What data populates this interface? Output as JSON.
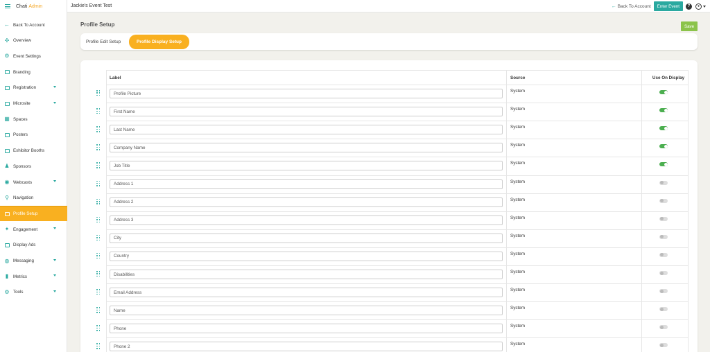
{
  "brand": {
    "name": "Chati",
    "suffix": "Admin"
  },
  "event": {
    "title": "Jackie's Event Test"
  },
  "topbar": {
    "back_label": "Back To Account",
    "enter_label": "Enter Event"
  },
  "sidebar": {
    "items": [
      {
        "label": "Back To Account",
        "icon": "arrow-left-icon",
        "glyph": "←",
        "caret": false,
        "active": false
      },
      {
        "label": "Overview",
        "icon": "overview-icon",
        "glyph": "✣",
        "caret": false,
        "active": false
      },
      {
        "label": "Event Settings",
        "icon": "settings-icon",
        "glyph": "⚙",
        "caret": false,
        "active": false
      },
      {
        "label": "Branding",
        "icon": "branding-icon",
        "glyph": "box",
        "caret": false,
        "active": false
      },
      {
        "label": "Registration",
        "icon": "registration-icon",
        "glyph": "box",
        "caret": true,
        "active": false
      },
      {
        "label": "Microsite",
        "icon": "microsite-icon",
        "glyph": "box",
        "caret": true,
        "active": false
      },
      {
        "label": "Spaces",
        "icon": "spaces-icon",
        "glyph": "▦",
        "caret": false,
        "active": false
      },
      {
        "label": "Posters",
        "icon": "posters-icon",
        "glyph": "box",
        "caret": false,
        "active": false
      },
      {
        "label": "Exhibitor Booths",
        "icon": "booth-icon",
        "glyph": "box",
        "caret": false,
        "active": false
      },
      {
        "label": "Sponsors",
        "icon": "sponsors-icon",
        "glyph": "♟",
        "caret": false,
        "active": false
      },
      {
        "label": "Webcasts",
        "icon": "webcasts-icon",
        "glyph": "◉",
        "caret": true,
        "active": false
      },
      {
        "label": "Navigation",
        "icon": "navigation-icon",
        "glyph": "⚲",
        "caret": false,
        "active": false
      },
      {
        "label": "Profile Setup",
        "icon": "profile-setup-icon",
        "glyph": "box",
        "caret": false,
        "active": true
      },
      {
        "label": "Engagement",
        "icon": "engagement-icon",
        "glyph": "✦",
        "caret": true,
        "active": false
      },
      {
        "label": "Display Ads",
        "icon": "display-ads-icon",
        "glyph": "box",
        "caret": false,
        "active": false
      },
      {
        "label": "Messaging",
        "icon": "messaging-icon",
        "glyph": "◍",
        "caret": true,
        "active": false
      },
      {
        "label": "Metrics",
        "icon": "metrics-icon",
        "glyph": "▮",
        "caret": true,
        "active": false
      },
      {
        "label": "Tools",
        "icon": "tools-icon",
        "glyph": "⚙",
        "caret": true,
        "active": false
      }
    ]
  },
  "main": {
    "title": "Profile Setup",
    "save_label": "Save",
    "tabs": [
      {
        "label": "Profile Edit Setup",
        "active": false
      },
      {
        "label": "Profile Display Setup",
        "active": true
      }
    ],
    "table": {
      "headers": {
        "label": "Label",
        "source": "Source",
        "use": "Use On Display"
      },
      "rows": [
        {
          "label": "Profile Picture",
          "source": "System",
          "use": true
        },
        {
          "label": "First Name",
          "source": "System",
          "use": true
        },
        {
          "label": "Last Name",
          "source": "System",
          "use": true
        },
        {
          "label": "Company Name",
          "source": "System",
          "use": true
        },
        {
          "label": "Job Title",
          "source": "System",
          "use": true
        },
        {
          "label": "Address 1",
          "source": "System",
          "use": false
        },
        {
          "label": "Address 2",
          "source": "System",
          "use": false
        },
        {
          "label": "Address 3",
          "source": "System",
          "use": false
        },
        {
          "label": "City",
          "source": "System",
          "use": false
        },
        {
          "label": "Country",
          "source": "System",
          "use": false
        },
        {
          "label": "Disabilities",
          "source": "System",
          "use": false
        },
        {
          "label": "Email Address",
          "source": "System",
          "use": false
        },
        {
          "label": "Name",
          "source": "System",
          "use": false
        },
        {
          "label": "Phone",
          "source": "System",
          "use": false
        },
        {
          "label": "Phone 2",
          "source": "System",
          "use": false
        }
      ]
    }
  },
  "colors": {
    "accent": "#2aa9a0",
    "active": "#f9b020",
    "save": "#8bc34a",
    "toggle_on": "#4caf50"
  }
}
